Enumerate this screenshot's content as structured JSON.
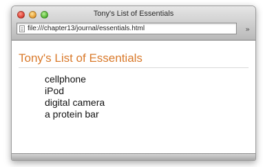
{
  "window": {
    "title": "Tony's List of Essentials"
  },
  "toolbar": {
    "url": "file:///chapter13/journal/essentials.html",
    "overflow_icon": "»"
  },
  "page": {
    "heading": "Tony's List of Essentials",
    "heading_color": "#d9792a",
    "items": [
      "cellphone",
      "iPod",
      "digital camera",
      "a protein bar"
    ]
  }
}
